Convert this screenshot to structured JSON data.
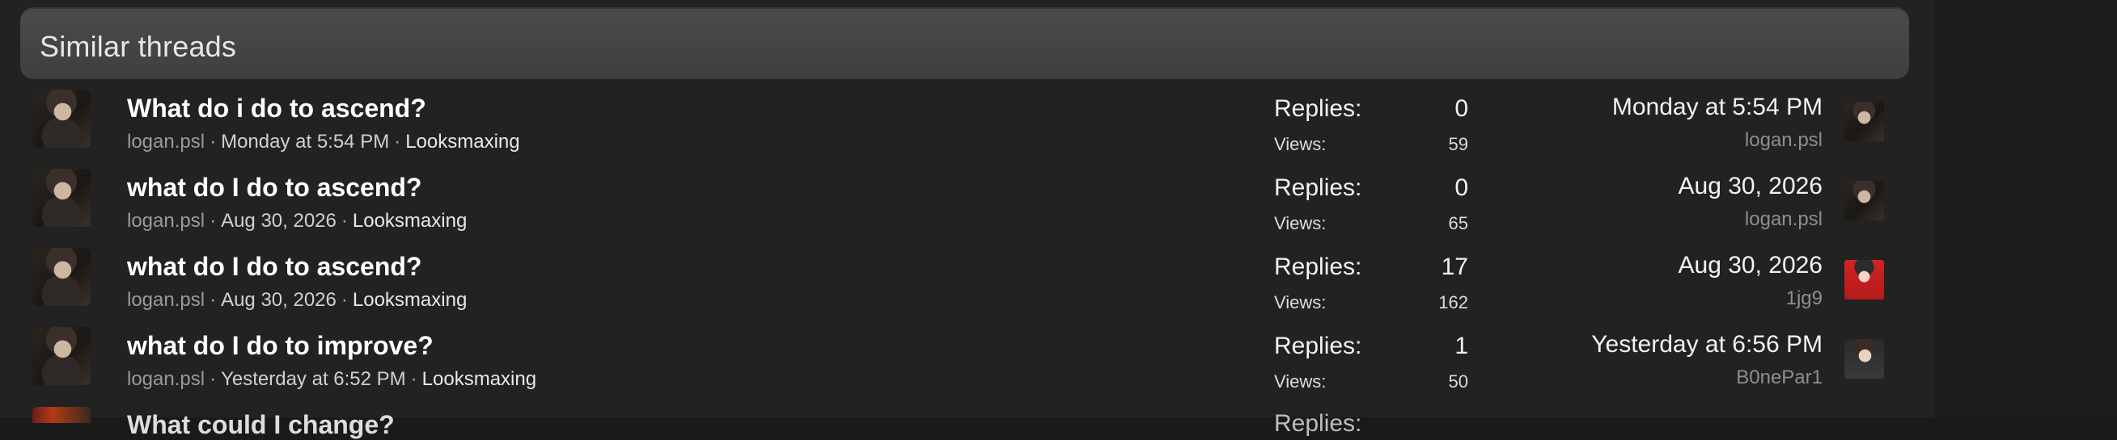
{
  "header": {
    "title": "Similar threads"
  },
  "threads": [
    {
      "title": "What do i do to ascend?",
      "author": "logan.psl",
      "date": "Monday at 5:54 PM",
      "forum": "Looksmaxing",
      "replies_label": "Replies:",
      "replies": "0",
      "views_label": "Views:",
      "views": "59",
      "last_post_date": "Monday at 5:54 PM",
      "last_post_user": "logan.psl",
      "last_post_avatar_icon": "logan-avatar-icon"
    },
    {
      "title": "what do I do to ascend?",
      "author": "logan.psl",
      "date": "Aug 30, 2026",
      "forum": "Looksmaxing",
      "replies_label": "Replies:",
      "replies": "0",
      "views_label": "Views:",
      "views": "65",
      "last_post_date": "Aug 30, 2026",
      "last_post_user": "logan.psl",
      "last_post_avatar_icon": "logan-avatar-icon"
    },
    {
      "title": "what do I do to ascend?",
      "author": "logan.psl",
      "date": "Aug 30, 2026",
      "forum": "Looksmaxing",
      "replies_label": "Replies:",
      "replies": "17",
      "views_label": "Views:",
      "views": "162",
      "last_post_date": "Aug 30, 2026",
      "last_post_user": "1jg9",
      "last_post_avatar_icon": "1jg9-avatar-icon"
    },
    {
      "title": "what do I do to improve?",
      "author": "logan.psl",
      "date": "Yesterday at 6:52 PM",
      "forum": "Looksmaxing",
      "replies_label": "Replies:",
      "replies": "1",
      "views_label": "Views:",
      "views": "50",
      "last_post_date": "Yesterday at 6:56 PM",
      "last_post_user": "B0nePar1",
      "last_post_avatar_icon": "b0nepar1-avatar-icon"
    }
  ],
  "partial_row": {
    "title": "What could I change?",
    "replies_label": "Replies:"
  },
  "colors": {
    "panel_bg": "#222222",
    "header_bg": "#454545",
    "title_text": "#ffffff",
    "meta_text": "#d0d0d0",
    "muted_text": "#8e8e8e"
  }
}
